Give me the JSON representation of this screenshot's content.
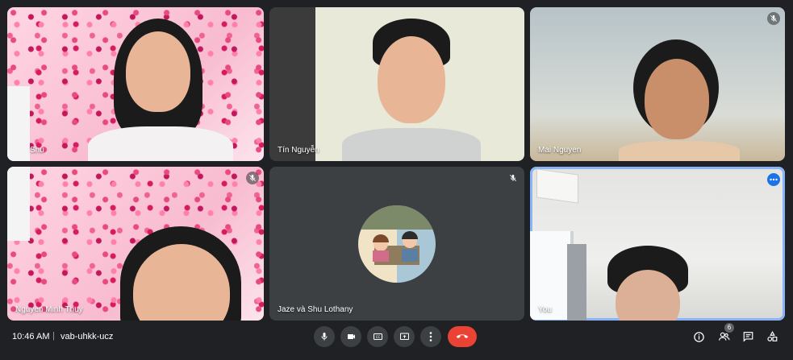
{
  "participants": [
    {
      "name": "Shu",
      "muted": false
    },
    {
      "name": "Tín Nguyễn",
      "muted": false
    },
    {
      "name": "Mai Nguyen",
      "muted": true
    },
    {
      "name": "Nguyen Minh Thuy",
      "muted": true
    },
    {
      "name": "Jaze và Shu Lothany",
      "muted": true
    },
    {
      "name": "You",
      "muted": false
    }
  ],
  "footer": {
    "time": "10:46 AM",
    "separator": "|",
    "meeting_code": "vab-uhkk-ucz",
    "people_count": "6"
  },
  "colors": {
    "background": "#202124",
    "tile": "#3c4043",
    "active_border": "#8ab4f8",
    "end_call": "#ea4335"
  },
  "icons": [
    "mic-icon",
    "camera-icon",
    "captions-icon",
    "present-icon",
    "more-options-icon",
    "end-call-icon",
    "info-icon",
    "people-icon",
    "chat-icon",
    "activities-icon",
    "mic-off-icon"
  ]
}
